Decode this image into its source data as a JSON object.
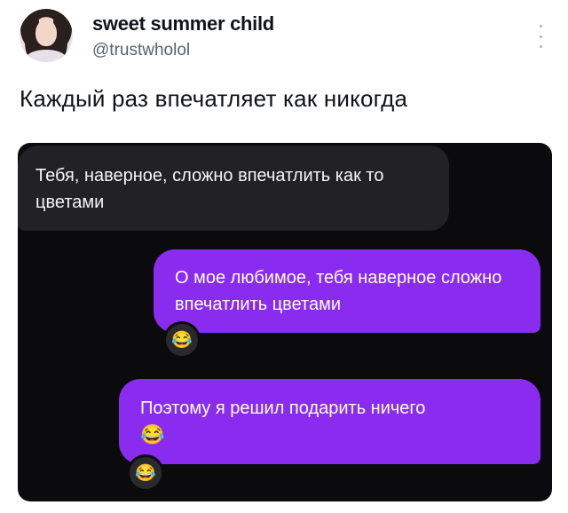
{
  "tweet": {
    "author_name": "sweet summer child",
    "author_handle": "@trustwholol",
    "text": "Каждый раз впечатляет как никогда"
  },
  "chat": {
    "messages": [
      {
        "direction": "incoming",
        "text": "Тебя, наверное, сложно впечатлить как то цветами"
      },
      {
        "direction": "outgoing",
        "text": "О мое любимое, тебя наверное сложно впечатлить цветами",
        "reaction": "😂"
      },
      {
        "direction": "outgoing",
        "text": "Поэтому я решил подарить ничего",
        "emoji": "😂",
        "reaction": "😂"
      }
    ]
  },
  "icons": {
    "more": "more-vertical-icon",
    "avatar": "profile-photo"
  },
  "colors": {
    "chat_background": "#0b0b0d",
    "incoming_bubble": "#222226",
    "outgoing_bubble": "#8a2cf0",
    "handle": "#536471"
  }
}
